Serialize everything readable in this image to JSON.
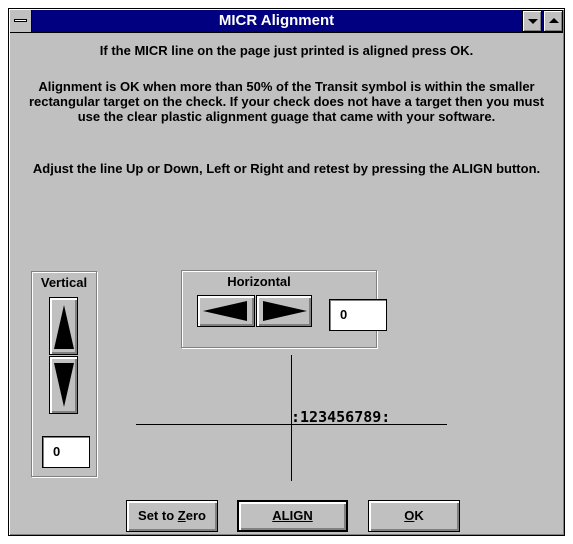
{
  "window": {
    "title": "MICR Alignment"
  },
  "messages": {
    "line1": "If the MICR line on the page just printed is aligned press OK.",
    "line2": "Alignment is OK when more than 50% of the Transit symbol is within the smaller rectangular target on the check. If your check does not have a target then you must use the clear plastic alignment guage that came with your software.",
    "line3": "Adjust the line Up or Down, Left or Right and retest by pressing the ALIGN button."
  },
  "vertical": {
    "label": "Vertical",
    "value": "0"
  },
  "horizontal": {
    "label": "Horizontal",
    "value": "0"
  },
  "micr_line": ":123456789:",
  "buttons": {
    "set_to_zero_prefix": "Set to ",
    "set_to_zero_mnemonic": "Z",
    "set_to_zero_suffix": "ero",
    "align_mnemonic": "A",
    "align_suffix": "LIGN",
    "ok_mnemonic": "O",
    "ok_suffix": "K"
  },
  "icons": {
    "system_menu": "system-menu-icon",
    "minimize": "minimize-icon",
    "maximize": "maximize-icon",
    "up": "arrow-up-icon",
    "down": "arrow-down-icon",
    "left": "arrow-left-icon",
    "right": "arrow-right-icon"
  },
  "colors": {
    "title_bar": "#000080",
    "face": "#c0c0c0"
  }
}
